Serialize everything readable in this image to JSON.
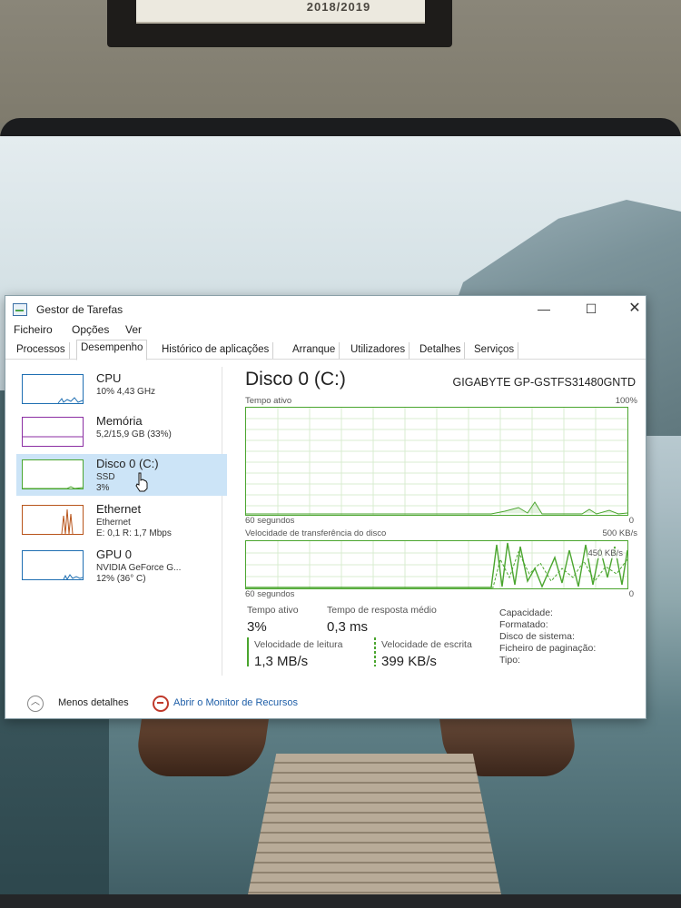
{
  "backdrop": {
    "frame_text": "2018/2019"
  },
  "window": {
    "title": "Gestor de Tarefas",
    "controls": {
      "minimize": "—",
      "maximize": "☐",
      "close": "✕"
    }
  },
  "menu": [
    "Ficheiro",
    "Opções",
    "Ver"
  ],
  "tabs": [
    "Processos",
    "Desempenho",
    "Histórico de aplicações",
    "Arranque",
    "Utilizadores",
    "Detalhes",
    "Serviços"
  ],
  "active_tab": "Desempenho",
  "sidebar": [
    {
      "name": "CPU",
      "sub1": "10% 4,43 GHz",
      "sub2": "",
      "color": "#1f6fb2"
    },
    {
      "name": "Memória",
      "sub1": "5,2/15,9 GB (33%)",
      "sub2": "",
      "color": "#8b2ea3"
    },
    {
      "name": "Disco 0 (C:)",
      "sub1": "SSD",
      "sub2": "3%",
      "color": "#4aa52e"
    },
    {
      "name": "Ethernet",
      "sub1": "Ethernet",
      "sub2": "E: 0,1 R: 1,7 Mbps",
      "color": "#b8541a"
    },
    {
      "name": "GPU 0",
      "sub1": "NVIDIA GeForce G...",
      "sub2": "12% (36° C)",
      "color": "#1f6fb2"
    }
  ],
  "selected_resource": "Disco 0 (C:)",
  "detail": {
    "title": "Disco 0 (C:)",
    "model": "GIGABYTE GP-GSTFS31480GNTD",
    "graph1": {
      "label": "Tempo ativo",
      "max": "100%",
      "time": "60 segundos",
      "min": "0"
    },
    "graph2": {
      "label": "Velocidade de transferência do disco",
      "max": "500 KB/s",
      "marker": "450 KB/s",
      "time": "60 segundos",
      "min": "0"
    },
    "stats": {
      "active_label": "Tempo ativo",
      "active_value": "3%",
      "response_label": "Tempo de resposta médio",
      "response_value": "0,3 ms",
      "read_label": "Velocidade de leitura",
      "read_value": "1,3 MB/s",
      "write_label": "Velocidade de escrita",
      "write_value": "399 KB/s"
    },
    "properties": [
      "Capacidade:",
      "Formatado:",
      "Disco de sistema:",
      "Ficheiro de paginação:",
      "Tipo:"
    ]
  },
  "footer": {
    "less_details": "Menos detalhes",
    "open_monitor": "Abrir o Monitor de Recursos"
  }
}
